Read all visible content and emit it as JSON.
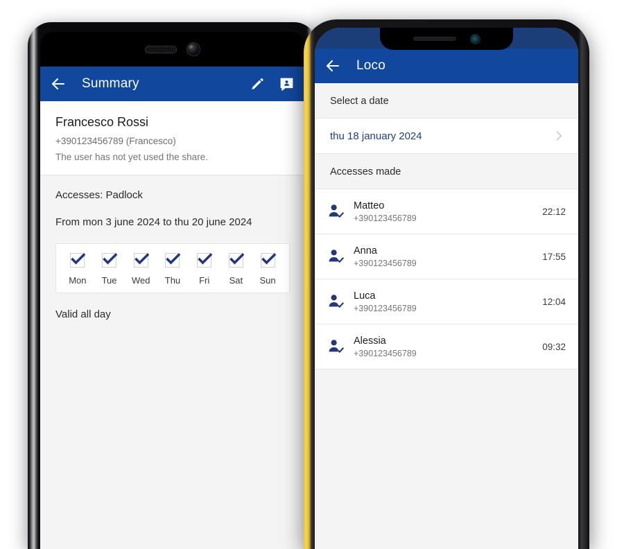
{
  "colors": {
    "appbar_blue": "#12479e",
    "statusbar_navy": "#1b3d78",
    "accent_navy": "#23387a",
    "link_blue": "#1d3f8a",
    "page_gray": "#f4f4f4",
    "card_white": "#ffffff",
    "bezel_yellow": "#e9c53b"
  },
  "left_phone": {
    "device": "android-phone",
    "appbar": {
      "back_icon": "arrow-left-icon",
      "title": "Summary",
      "actions": [
        {
          "icon": "pencil-edit-icon",
          "name": "edit-button"
        },
        {
          "icon": "person-message-icon",
          "name": "contact-message-button"
        }
      ]
    },
    "user": {
      "name": "Francesco Rossi",
      "phone": "+390123456789 (Francesco)",
      "status_note": "The user has not yet used the share."
    },
    "access_section": {
      "title": "Accesses: Padlock",
      "date_range": "From mon 3 june 2024 to thu 20 june 2024",
      "weekdays": [
        {
          "label": "Mon",
          "checked": true
        },
        {
          "label": "Tue",
          "checked": true
        },
        {
          "label": "Wed",
          "checked": true
        },
        {
          "label": "Thu",
          "checked": true
        },
        {
          "label": "Fri",
          "checked": true
        },
        {
          "label": "Sat",
          "checked": true
        },
        {
          "label": "Sun",
          "checked": true
        }
      ],
      "validity": "Valid all day"
    }
  },
  "right_phone": {
    "device": "iphone-notch-yellow-case",
    "appbar": {
      "back_icon": "arrow-left-icon",
      "title": "Loco"
    },
    "date_picker": {
      "label": "Select a date",
      "value": "thu 18 january 2024",
      "chevron_icon": "chevron-right-icon"
    },
    "accesses": {
      "header": "Accesses made",
      "rows": [
        {
          "icon": "person-check-icon",
          "name": "Matteo",
          "phone": "+390123456789",
          "time": "22:12"
        },
        {
          "icon": "person-check-icon",
          "name": "Anna",
          "phone": "+390123456789",
          "time": "17:55"
        },
        {
          "icon": "person-check-icon",
          "name": "Luca",
          "phone": "+390123456789",
          "time": "12:04"
        },
        {
          "icon": "person-check-icon",
          "name": "Alessia",
          "phone": "+390123456789",
          "time": "09:32"
        }
      ]
    }
  }
}
